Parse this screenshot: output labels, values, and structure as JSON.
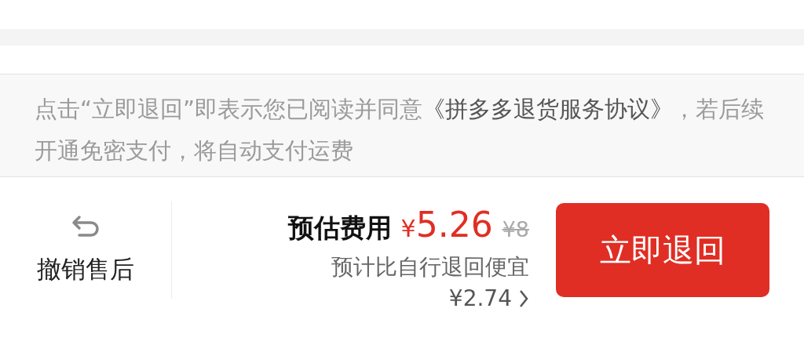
{
  "notice": "点击“立即退回”即表示您已阅读并同意**《拼多多退货服务协议》**，若后续开通免密支付，将自动支付运费",
  "undo": {
    "label": "撤销售后"
  },
  "estimate": {
    "label": "预估费用",
    "currency": "¥",
    "price": "5.26",
    "original_price": "¥8",
    "saving_label": "预计比自行退回便宜",
    "saving": "¥2.74"
  },
  "submit_button": "立即退回"
}
